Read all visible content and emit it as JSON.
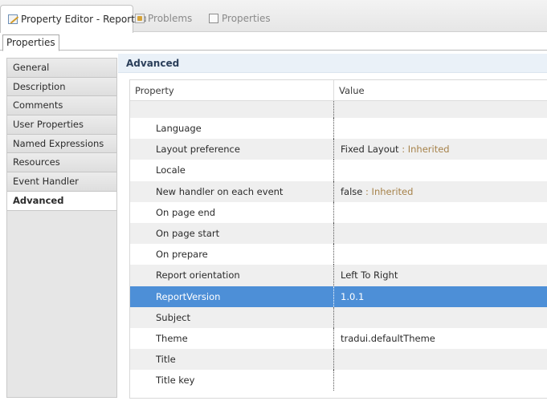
{
  "tabs": [
    {
      "label": "Property Editor - Report",
      "icon": "property-editor-icon",
      "close": "⊠",
      "active": true
    },
    {
      "label": "Problems",
      "icon": "problems-icon",
      "active": false
    },
    {
      "label": "Properties",
      "icon": "properties-icon",
      "active": false
    }
  ],
  "subtab": {
    "label": "Properties"
  },
  "categories": [
    {
      "label": "General"
    },
    {
      "label": "Description"
    },
    {
      "label": "Comments"
    },
    {
      "label": "User Properties"
    },
    {
      "label": "Named Expressions"
    },
    {
      "label": "Resources"
    },
    {
      "label": "Event Handler"
    },
    {
      "label": "Advanced",
      "selected": true
    }
  ],
  "section": {
    "title": "Advanced"
  },
  "grid": {
    "headers": {
      "property": "Property",
      "value": "Value"
    },
    "rows": [
      {
        "property": "Language",
        "value": ""
      },
      {
        "property": "Layout preference",
        "value": "Fixed Layout",
        "inherited": "Inherited"
      },
      {
        "property": "Locale",
        "value": ""
      },
      {
        "property": "New handler on each event",
        "value": "false",
        "inherited": "Inherited"
      },
      {
        "property": "On page end",
        "value": ""
      },
      {
        "property": "On page start",
        "value": ""
      },
      {
        "property": "On prepare",
        "value": ""
      },
      {
        "property": "Report orientation",
        "value": "Left To Right"
      },
      {
        "property": "ReportVersion",
        "value": "1.0.1",
        "selected": true
      },
      {
        "property": "Subject",
        "value": ""
      },
      {
        "property": "Theme",
        "value": "tradui.defaultTheme"
      },
      {
        "property": "Title",
        "value": ""
      },
      {
        "property": "Title key",
        "value": ""
      }
    ]
  },
  "colors": {
    "selection": "#4d8fd7",
    "inherited": "#a6824a",
    "section_bg": "#eaf1f8"
  }
}
